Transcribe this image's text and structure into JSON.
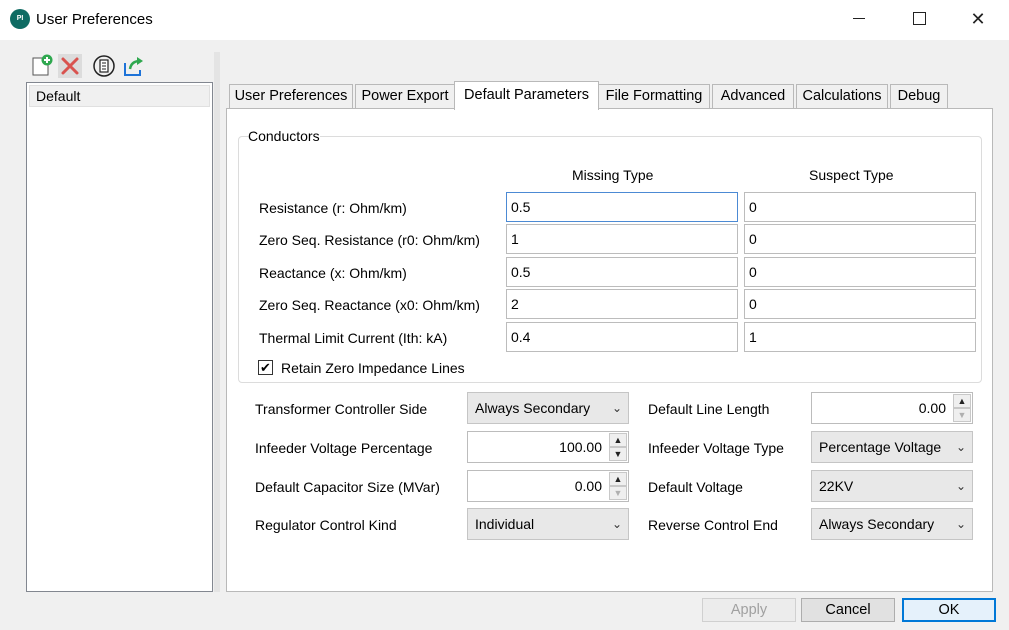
{
  "window": {
    "title": "User Preferences",
    "app_icon_text": "PI"
  },
  "toolbar": {
    "icons": [
      "add-profile-icon",
      "delete-profile-icon",
      "copy-profile-icon",
      "export-profile-icon"
    ]
  },
  "profiles": {
    "items": [
      {
        "label": "Default"
      }
    ]
  },
  "tabs": [
    {
      "label": "User Preferences"
    },
    {
      "label": "Power Export"
    },
    {
      "label": "Default Parameters",
      "active": true
    },
    {
      "label": "File Formatting"
    },
    {
      "label": "Advanced"
    },
    {
      "label": "Calculations"
    },
    {
      "label": "Debug"
    }
  ],
  "conductors": {
    "title": "Conductors",
    "col_missing": "Missing Type",
    "col_suspect": "Suspect Type",
    "rows": [
      {
        "label": "Resistance (r: Ohm/km)",
        "missing": "0.5",
        "suspect": "0"
      },
      {
        "label": "Zero Seq. Resistance (r0: Ohm/km)",
        "missing": "1",
        "suspect": "0"
      },
      {
        "label": "Reactance (x: Ohm/km)",
        "missing": "0.5",
        "suspect": "0"
      },
      {
        "label": "Zero Seq. Reactance (x0: Ohm/km)",
        "missing": "2",
        "suspect": "0"
      },
      {
        "label": "Thermal Limit Current (Ith: kA)",
        "missing": "0.4",
        "suspect": "1"
      }
    ],
    "retain_label": "Retain Zero Impedance Lines",
    "retain_checked": true,
    "check_glyph": "✔"
  },
  "settings": {
    "transformer_controller_side": {
      "label": "Transformer Controller Side",
      "value": "Always Secondary"
    },
    "infeeder_voltage_percentage": {
      "label": "Infeeder Voltage Percentage",
      "value": "100.00"
    },
    "default_capacitor_size": {
      "label": "Default Capacitor Size (MVar)",
      "value": "0.00"
    },
    "regulator_control_kind": {
      "label": "Regulator Control Kind",
      "value": "Individual"
    },
    "default_line_length": {
      "label": "Default Line Length",
      "value": "0.00"
    },
    "infeeder_voltage_type": {
      "label": "Infeeder Voltage Type",
      "value": "Percentage Voltage"
    },
    "default_voltage": {
      "label": "Default Voltage",
      "value": "22KV"
    },
    "reverse_control_end": {
      "label": "Reverse Control End",
      "value": "Always Secondary"
    }
  },
  "buttons": {
    "apply": "Apply",
    "cancel": "Cancel",
    "ok": "OK"
  },
  "colors": {
    "accent": "#0078d7",
    "focus_border": "#4c8ad4",
    "app_icon": "#0f6b63"
  }
}
